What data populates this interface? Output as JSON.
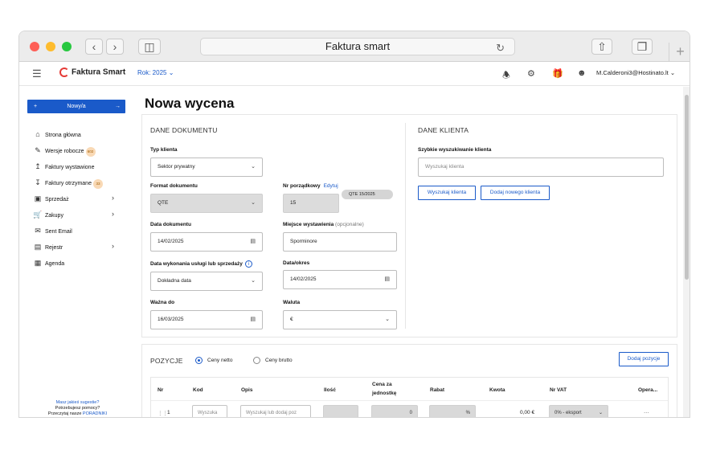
{
  "browser": {
    "title": "Faktura smart"
  },
  "header": {
    "brand": "Faktura Smart",
    "year": "Rok: 2025",
    "user": "M.Calderoni3@Hostinato.lt"
  },
  "sidebar": {
    "new_button": "Nowy/a",
    "items": [
      {
        "label": "Strona główna",
        "icon": "home-icon"
      },
      {
        "label": "Wersje robocze",
        "icon": "draft-icon",
        "badge": "602"
      },
      {
        "label": "Faktury wystawione",
        "icon": "upload-icon"
      },
      {
        "label": "Faktury otrzymane",
        "icon": "download-icon",
        "badge": "33"
      },
      {
        "label": "Sprzedaż",
        "icon": "sales-icon"
      },
      {
        "label": "Zakupy",
        "icon": "cart-icon"
      },
      {
        "label": "Sent Email",
        "icon": "email-icon"
      },
      {
        "label": "Rejestr",
        "icon": "register-icon"
      },
      {
        "label": "Agenda",
        "icon": "calendar-icon"
      }
    ],
    "help_line1": "Masz jakieś sugestie?",
    "help_line2": "Potrzebujesz pomocy?",
    "help_line3_prefix": "Przeczytaj nasze ",
    "help_line3_link": "PORADNIKI"
  },
  "main": {
    "title": "Nowa wycena",
    "document": {
      "section": "DANE DOKUMENTU",
      "client_type_label": "Typ klienta",
      "client_type_value": "Sektor prywatny",
      "format_label": "Format dokumentu",
      "format_value": "QTE",
      "number_label": "Nr porządkowy",
      "edit_link": "Edytuj",
      "number_value": "15",
      "number_pill": "QTE 15/2025",
      "date_label": "Data dokumentu",
      "date_value": "14/02/2025",
      "place_label": "Miejsce wystawienia",
      "place_optional": "(opcjonalne)",
      "place_value": "Sporminore",
      "service_date_label": "Data wykonania usługi lub sprzedaży",
      "service_date_value": "Dokładna data",
      "date_period_label": "Data/okres",
      "date_period_value": "14/02/2025",
      "valid_label": "Ważna do",
      "valid_value": "16/03/2025",
      "currency_label": "Waluta",
      "currency_value": "€"
    },
    "client": {
      "section": "DANE KLIENTA",
      "search_label": "Szybkie wyszukiwanie klienta",
      "search_placeholder": "Wyszukaj klienta",
      "search_button": "Wyszukaj klienta",
      "add_button": "Dodaj nowego klienta"
    },
    "positions": {
      "section": "POZYCJE",
      "radio_net": "Ceny netto",
      "radio_gross": "Ceny brutto",
      "add_button": "Dodaj pozycje",
      "columns": [
        "Nr",
        "Kod",
        "Opis",
        "Ilość",
        "Cena za",
        "jednostkę",
        "Rabat",
        "Kwota",
        "Nr VAT",
        "Opera..."
      ],
      "row": {
        "nr": "1",
        "code_placeholder": "Wyszuka",
        "desc_placeholder": "Wyszukaj lub dodaj poz",
        "price": "0",
        "discount": "%",
        "amount": "0,00 €",
        "vat": "0% - eksport",
        "ops": "···"
      }
    }
  }
}
